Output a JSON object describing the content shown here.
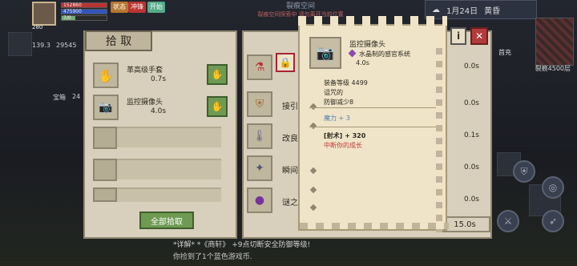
{
  "hud": {
    "hp": "152860",
    "mp": "475900",
    "other": "7/0",
    "buttons": [
      "状态",
      "冲锋",
      "开始"
    ],
    "level_badge": "280"
  },
  "crack_space": {
    "title": "裂痕空间",
    "subtitle": "裂痕空间探索中 请勿离开当前位置"
  },
  "date": {
    "day": "1月24日",
    "period": "黄昏"
  },
  "right_labels": {
    "map_label": "裂痕4500层",
    "first_charge": "首充"
  },
  "left_side": {
    "stat1": "139.3",
    "stat2": "29545",
    "chest_label": "宝箱",
    "chest_count": "24"
  },
  "pickup": {
    "title": "拾 取",
    "items": [
      {
        "name": "革高级手套",
        "time": "0.7s"
      },
      {
        "name": "监控摄像头",
        "time": "4.0s"
      }
    ],
    "all_button": "全部拾取"
  },
  "middle": {
    "rows": [
      {
        "label": "",
        "time": "0.0s"
      },
      {
        "label": "接引",
        "time": "0.0s"
      },
      {
        "label": "改良",
        "time": "0.1s"
      },
      {
        "label": "瞬间",
        "time": "0.0s"
      },
      {
        "label": "谜之",
        "time": "0.0s"
      }
    ],
    "bottom_time": "15.0s"
  },
  "tooltip": {
    "name": "监控摄像头",
    "type": "水晶制的感官系统",
    "time": "4.0s",
    "level": "装备等级 4499",
    "cursed": "诅咒的",
    "defense": "防御减少8",
    "magic": "魔力 + 3",
    "shot": "[射术] + 320",
    "interrupt": "中断你的成长"
  },
  "chat": {
    "line1": "*详解*  *《商轩》 +9点切断安全防御等级!",
    "line2": "你捡到了1个蓝色游戏币."
  }
}
